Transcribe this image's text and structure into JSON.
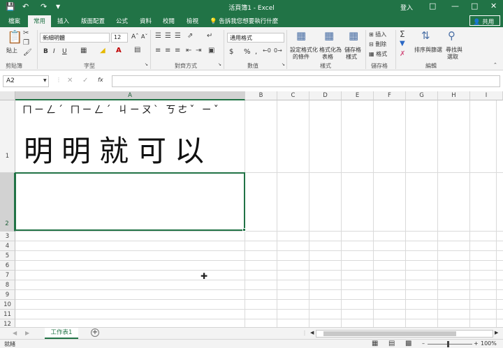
{
  "title_bar": {
    "title": "活頁簿1 - Excel",
    "login": "登入"
  },
  "ribbon_tabs": [
    "檔案",
    "常用",
    "插入",
    "版面配置",
    "公式",
    "資料",
    "校閱",
    "檢視"
  ],
  "tell_me": "告訴我您想要執行什麼",
  "share": "共用",
  "ribbon": {
    "clipboard": {
      "paste": "貼上",
      "label": "剪貼簿"
    },
    "font": {
      "name": "新細明體",
      "size": "12",
      "bold": "B",
      "italic": "I",
      "underline": "U",
      "label": "字型"
    },
    "alignment": {
      "label": "對齊方式"
    },
    "number": {
      "format": "通用格式",
      "label": "數值"
    },
    "styles": {
      "conditional_1": "設定格式化",
      "conditional_2": "的條件",
      "table_1": "格式化為",
      "table_2": "表格",
      "cell_1": "儲存格",
      "cell_2": "樣式",
      "label": "樣式"
    },
    "cells": {
      "insert": "插入",
      "delete": "刪除",
      "format": "格式",
      "label": "儲存格"
    },
    "editing": {
      "sort_1": "排序與篩選",
      "find_1": "尋找與",
      "find_2": "選取",
      "label": "編輯"
    }
  },
  "formula_bar": {
    "name_box": "A2",
    "fx": "fx",
    "content": ""
  },
  "columns": [
    "A",
    "B",
    "C",
    "D",
    "E",
    "F",
    "G",
    "H",
    "I"
  ],
  "rows": [
    "1",
    "2",
    "3",
    "4",
    "5",
    "6",
    "7",
    "8",
    "9",
    "10",
    "11",
    "12"
  ],
  "cell_a1": {
    "phonetic": "ㄇㄧㄥˊ ㄇㄧㄥˊ ㄐㄧㄡˋ ㄎㄜˇ ㄧˇ",
    "text": "明明就可以"
  },
  "sheet": {
    "tab": "工作表1",
    "add": "+"
  },
  "status": {
    "ready": "就緒",
    "zoom": "100%"
  }
}
